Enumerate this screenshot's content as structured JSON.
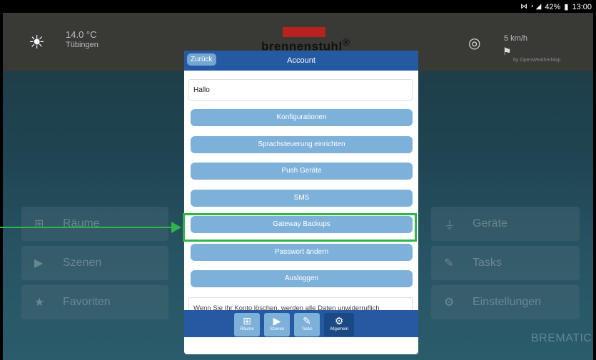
{
  "status_bar": {
    "icons": "⋈ ◔ ◢",
    "battery": "42%",
    "time": "13:00"
  },
  "weather": {
    "temperature": "14.0 °C",
    "city": "Tübingen",
    "wind_speed": "5 km/h",
    "provider": "by OpenWeatherMap"
  },
  "brand": {
    "logo_text": "brennenstuhl",
    "trademark": "®",
    "footer_brand": "BREMATIC"
  },
  "background_tiles": {
    "left": [
      {
        "icon": "rooms-icon",
        "label": "Räume"
      },
      {
        "icon": "scenes-icon",
        "label": "Szenen"
      },
      {
        "icon": "star-icon",
        "label": "Favoriten"
      }
    ],
    "right": [
      {
        "icon": "plug-icon",
        "label": "Geräte"
      },
      {
        "icon": "tasks-icon",
        "label": "Tasks"
      },
      {
        "icon": "gears-icon",
        "label": "Einstellungen"
      }
    ]
  },
  "dialog": {
    "back_label": "Zurück",
    "title": "Account",
    "greeting": "Hallo",
    "buttons": [
      "Konfigurationen",
      "Sprachsteuerung einrichten",
      "Push Geräte",
      "SMS",
      "Gateway Backups",
      "Passwort ändern",
      "Ausloggen"
    ],
    "note": "Wenn Sie Ihr Konto löschen, werden alle Daten unwiderruflich"
  },
  "tabbar": {
    "tabs": [
      {
        "label": "Räume",
        "icon": "rooms-icon"
      },
      {
        "label": "Szenen",
        "icon": "scenes-icon"
      },
      {
        "label": "Tasks",
        "icon": "tasks-icon"
      },
      {
        "label": "Allgemein",
        "icon": "gears-icon",
        "active": true
      }
    ]
  },
  "colors": {
    "accent": "#255aa3",
    "button": "#7eb1da",
    "highlight": "#2fb54a"
  }
}
